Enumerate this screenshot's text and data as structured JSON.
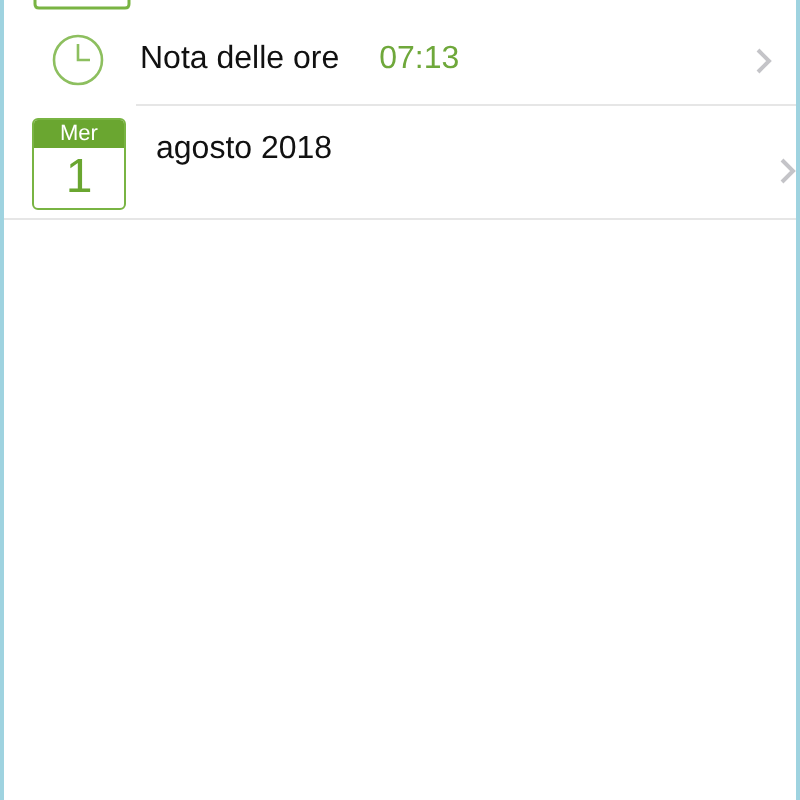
{
  "rows": [
    {
      "kind": "time",
      "label": "Nota delle ore",
      "time": "07:13"
    },
    {
      "kind": "date",
      "weekday": "Mer",
      "day": "1",
      "label": "agosto 2018"
    }
  ]
}
